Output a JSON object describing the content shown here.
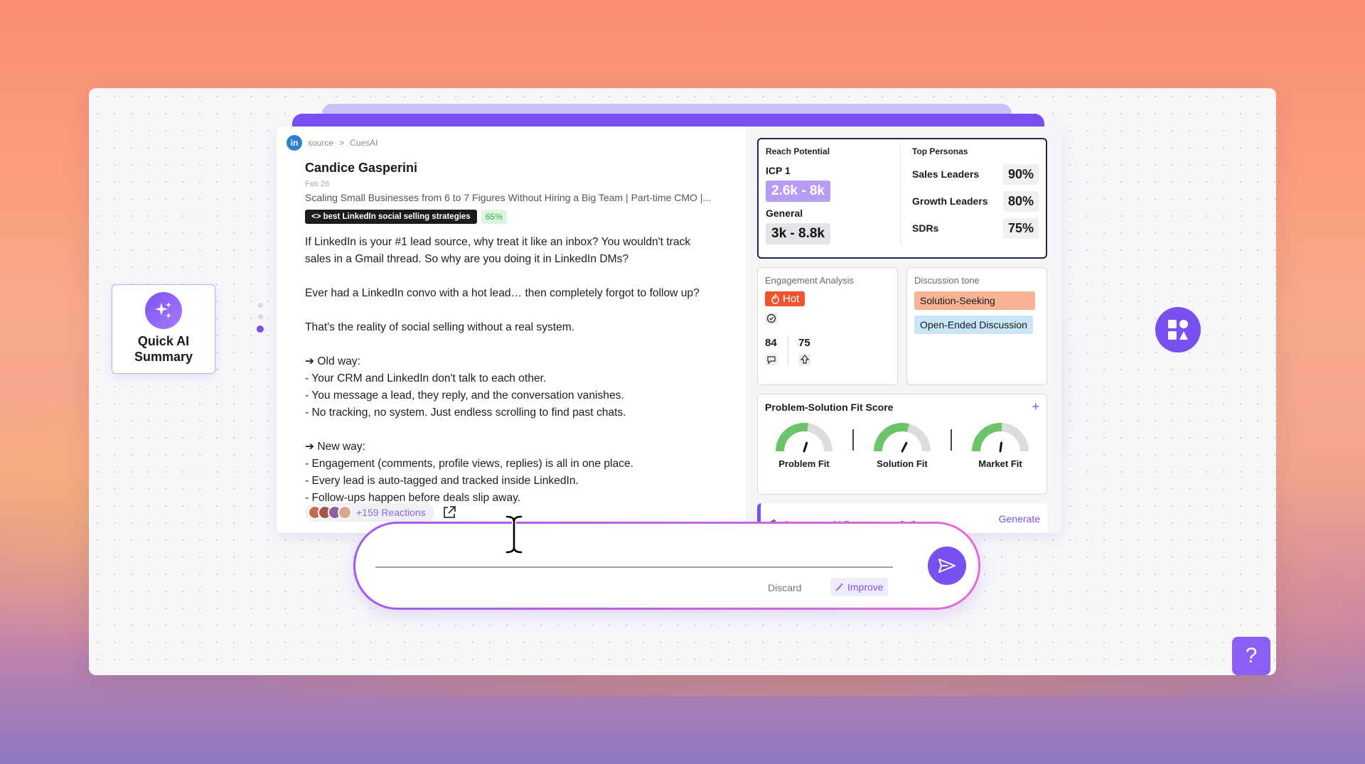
{
  "breadcrumb": {
    "source": "source",
    "sep": ">",
    "app": "CuesAI"
  },
  "post": {
    "author": "Candice Gasperini",
    "date": "Feb 26",
    "headline": "Scaling Small Businesses from 6 to 7 Figures Without Hiring a Big Team | Part-time CMO |...",
    "tag_keyword": "best LinkedIn social selling strategies",
    "tag_score": "65%",
    "body": [
      "If LinkedIn is your #1 lead source, why treat it like an inbox? You wouldn't track",
      "sales in a Gmail thread. So why are you doing it in LinkedIn DMs?",
      "",
      "Ever had a LinkedIn convo with a hot lead… then completely forgot to follow up?",
      "",
      "That's the reality of social selling without a real system.",
      "",
      "➔ Old way:",
      "- Your CRM and LinkedIn don't talk to each other.",
      "- You message a lead, they reply, and the conversation vanishes.",
      "- No tracking, no system. Just endless scrolling to find past chats.",
      "",
      "➔ New way:",
      "- Engagement (comments, profile views, replies) is all in one place.",
      "- Every lead is auto-tagged and tracked inside LinkedIn.",
      "- Follow-ups happen before deals slip away."
    ],
    "reactions": "+159 Reactions"
  },
  "reach": {
    "title": "Reach Potential",
    "icp_label": "ICP 1",
    "icp_value": "2.6k - 8k",
    "general_label": "General",
    "general_value": "3k - 8.8k",
    "personas_title": "Top Personas",
    "personas": [
      {
        "name": "Sales Leaders",
        "value": "90%"
      },
      {
        "name": "Growth Leaders",
        "value": "80%"
      },
      {
        "name": "SDRs",
        "value": "75%"
      }
    ]
  },
  "engagement": {
    "title": "Engagement Analysis",
    "status": "Hot",
    "comments": "84",
    "upvotes": "75"
  },
  "tone": {
    "title": "Discussion tone",
    "chips": [
      "Solution-Seeking",
      "Open-Ended Discussion"
    ]
  },
  "psf": {
    "title": "Problem-Solution Fit Score",
    "add": "+",
    "gauges": [
      {
        "label": "Problem Fit",
        "level": 0.55
      },
      {
        "label": "Solution Fit",
        "level": 0.58
      },
      {
        "label": "Market Fit",
        "level": 0.52
      }
    ]
  },
  "comment": {
    "title": "Comment AI Recommendation",
    "action": "Generate"
  },
  "composer": {
    "discard": "Discard",
    "improve": "Improve"
  },
  "quick_ai": {
    "label": "Quick AI Summary"
  },
  "help": "?",
  "colors": {
    "accent": "#7a4ff0",
    "hot": "#f0532e",
    "gauge_green": "#6cc46a"
  }
}
